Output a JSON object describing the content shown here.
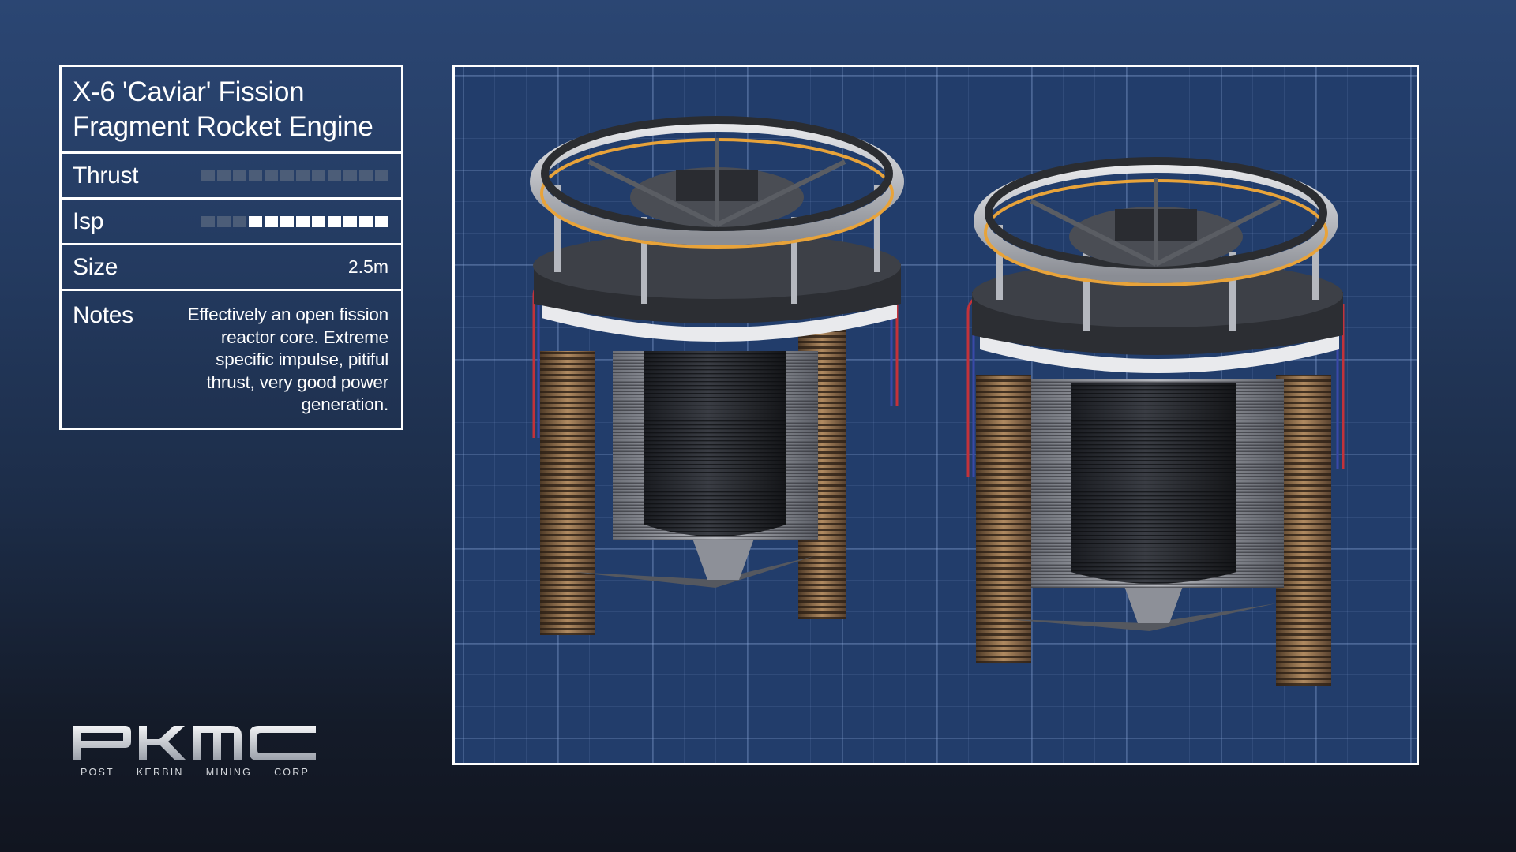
{
  "part": {
    "title_line1": "X-6 'Caviar' Fission",
    "title_line2": "Fragment Rocket Engine"
  },
  "stats": {
    "thrust": {
      "label": "Thrust",
      "rating": 0,
      "max": 12
    },
    "isp": {
      "label": "Isp",
      "rating": 9,
      "max": 12
    },
    "size": {
      "label": "Size",
      "value": "2.5m"
    },
    "notes": {
      "label": "Notes",
      "line1": "Effectively an open fission",
      "line2": "reactor core. Extreme",
      "line3": "specific impulse, pitiful",
      "line4": "thrust, very good power",
      "line5": "generation."
    }
  },
  "logo": {
    "wordmark": "PKMC",
    "tagline": [
      "POST",
      "KERBIN",
      "MINING",
      "CORP"
    ]
  },
  "colors": {
    "bar_on": "#ffffff",
    "bar_off": "#4c5d78",
    "accent_orange": "#e8a33a",
    "copper": "#a67c52"
  },
  "icons": {
    "viewer_subject": "fission-engine-render"
  }
}
